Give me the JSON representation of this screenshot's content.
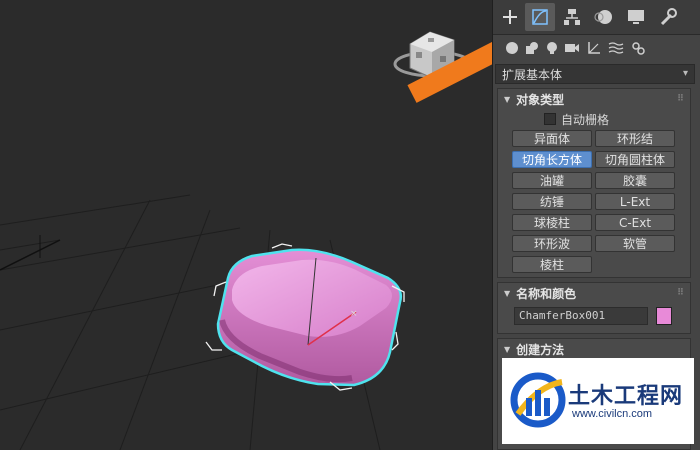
{
  "command_panel": {
    "tabs": [
      {
        "name": "create-icon"
      },
      {
        "name": "modify-icon",
        "active": true
      },
      {
        "name": "hierarchy-icon"
      },
      {
        "name": "motion-icon"
      },
      {
        "name": "display-icon"
      },
      {
        "name": "utilities-icon"
      }
    ],
    "category_icons": [
      "geometry-icon",
      "shapes-icon",
      "lights-icon",
      "cameras-icon",
      "helpers-icon",
      "spacewarps-icon",
      "systems-icon"
    ],
    "dropdown_value": "扩展基本体",
    "object_type": {
      "title": "对象类型",
      "autogrid_label": "自动栅格",
      "buttons": [
        {
          "label": "异面体"
        },
        {
          "label": "环形结"
        },
        {
          "label": "切角长方体",
          "selected": true
        },
        {
          "label": "切角圆柱体"
        },
        {
          "label": "油罐"
        },
        {
          "label": "胶囊"
        },
        {
          "label": "纺锤"
        },
        {
          "label": "L-Ext"
        },
        {
          "label": "球棱柱"
        },
        {
          "label": "C-Ext"
        },
        {
          "label": "环形波"
        },
        {
          "label": "软管"
        },
        {
          "label": "棱柱"
        }
      ]
    },
    "name_color": {
      "title": "名称和颜色",
      "object_name": "ChamferBox001",
      "color": "#e88ad8"
    },
    "creation_method": {
      "title": "创建方法"
    }
  },
  "watermark": {
    "title": "土木工程网",
    "url": "www.civilcn.com"
  },
  "colors": {
    "arrow": "#f07a1c",
    "selection_outline": "#4fe3ee",
    "object": "#e88ad8",
    "selected_button": "#5e8fcf"
  }
}
